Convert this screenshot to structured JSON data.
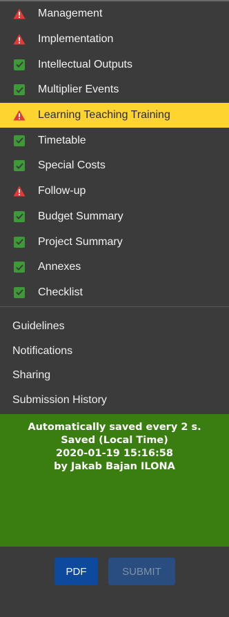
{
  "nav": {
    "items": [
      {
        "label": "Management",
        "status": "warning"
      },
      {
        "label": "Implementation",
        "status": "warning"
      },
      {
        "label": "Intellectual Outputs",
        "status": "ok"
      },
      {
        "label": "Multiplier Events",
        "status": "ok"
      },
      {
        "label": "Learning Teaching Training",
        "status": "warning",
        "active": true
      },
      {
        "label": "Timetable",
        "status": "ok"
      },
      {
        "label": "Special Costs",
        "status": "ok"
      },
      {
        "label": "Follow-up",
        "status": "warning"
      },
      {
        "label": "Budget Summary",
        "status": "ok"
      },
      {
        "label": "Project Summary",
        "status": "ok"
      },
      {
        "label": "Annexes",
        "status": "ok"
      },
      {
        "label": "Checklist",
        "status": "ok"
      }
    ]
  },
  "links": {
    "guidelines": "Guidelines",
    "notifications": "Notifications",
    "sharing": "Sharing",
    "submission_history": "Submission History"
  },
  "save_status": {
    "line1": "Automatically saved every 2 s.",
    "line2": "Saved (Local Time)",
    "line3": "2020-01-19 15:16:58",
    "line4": "by Jakab Bajan ILONA"
  },
  "buttons": {
    "pdf": "PDF",
    "submit": "SUBMIT"
  },
  "colors": {
    "background": "#3b3b3b",
    "active_highlight": "#fdd430",
    "warning_red": "#e53935",
    "ok_green": "#3e9a39",
    "saved_panel": "#3a7d10",
    "pdf_button": "#0d4a9e",
    "submit_button_disabled": "#284d7e"
  },
  "icons": {
    "warning": "warning-triangle-icon",
    "ok": "check-square-icon"
  }
}
